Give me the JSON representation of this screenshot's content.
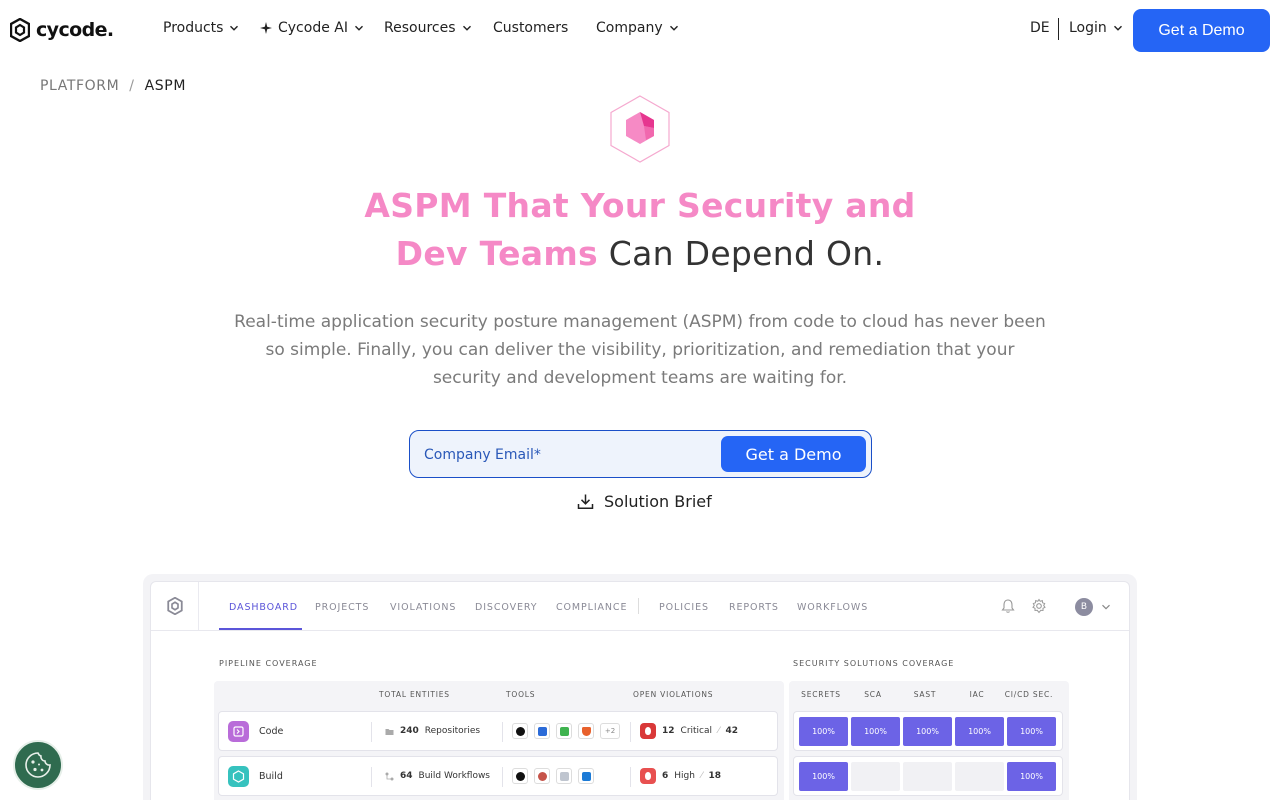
{
  "nav": {
    "logo_text": "cycode.",
    "items": [
      {
        "label": "Products",
        "has_menu": true
      },
      {
        "label": "Cycode AI",
        "has_menu": true,
        "icon": "sparkle-icon"
      },
      {
        "label": "Resources",
        "has_menu": true
      },
      {
        "label": "Customers",
        "has_menu": false
      },
      {
        "label": "Company",
        "has_menu": true
      }
    ],
    "language": "DE",
    "login_label": "Login",
    "cta_label": "Get a Demo",
    "cta_color": "#2565f5"
  },
  "breadcrumb": {
    "parent": "PLATFORM",
    "separator": "/",
    "current": "ASPM"
  },
  "hero": {
    "icon": "hexagon-cube-icon",
    "title_pink_1": "ASPM That Your Security and",
    "title_pink_2": "Dev Teams",
    "title_dark": "Can Depend On.",
    "accent_color": "#f589c6",
    "subtitle": "Real-time application security posture management (ASPM) from code to cloud has never been so simple. Finally, you can deliver the visibility, prioritization, and remediation that your security and development teams are waiting for.",
    "email_placeholder": "Company Email*",
    "email_button": "Get a Demo",
    "brief_label": "Solution Brief",
    "brief_icon": "download-icon"
  },
  "dashboard": {
    "tabs": [
      "DASHBOARD",
      "PROJECTS",
      "VIOLATIONS",
      "DISCOVERY",
      "COMPLIANCE",
      "POLICIES",
      "REPORTS",
      "WORKFLOWS"
    ],
    "active_tab": "DASHBOARD",
    "avatar_initial": "B",
    "pipeline": {
      "title": "PIPELINE COVERAGE",
      "columns": [
        "TOTAL ENTITIES",
        "TOOLS",
        "OPEN VIOLATIONS"
      ],
      "rows": [
        {
          "name": "Code",
          "entities_count": "240",
          "entities_label": "Repositories",
          "tools_more": "+2",
          "violations_count": "12",
          "violations_level": "Critical",
          "violations_total": "42"
        },
        {
          "name": "Build",
          "entities_count": "64",
          "entities_label": "Build Workflows",
          "violations_count": "6",
          "violations_level": "High",
          "violations_total": "18"
        }
      ]
    },
    "coverage": {
      "title": "SECURITY SOLUTIONS COVERAGE",
      "columns": [
        "SECRETS",
        "SCA",
        "SAST",
        "IAC",
        "CI/CD SEC."
      ],
      "rows": [
        [
          "100%",
          "100%",
          "100%",
          "100%",
          "100%"
        ],
        [
          "100%",
          "",
          "",
          "",
          "100%"
        ]
      ],
      "fill_color": "#6c63e6"
    }
  },
  "cookie_icon": "cookie-icon"
}
